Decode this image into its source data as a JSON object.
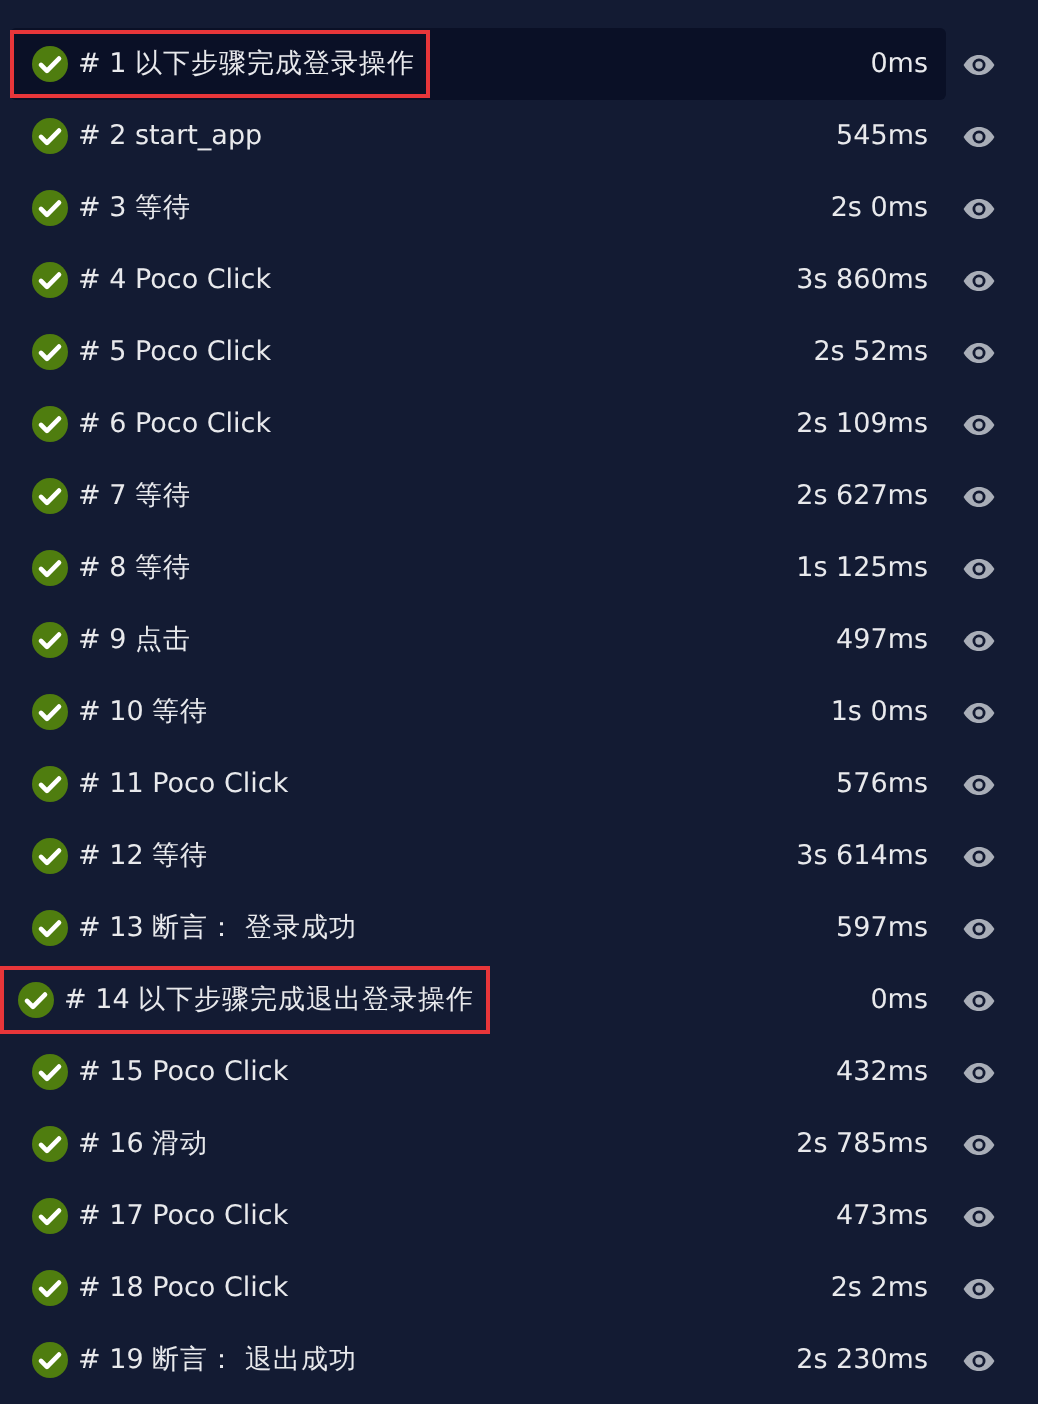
{
  "steps": [
    {
      "label": "# 1 以下步骤完成登录操作",
      "duration": "0ms",
      "passed": true,
      "selected": true,
      "flagged": true
    },
    {
      "label": "# 2 start_app",
      "duration": "545ms",
      "passed": true,
      "selected": false,
      "flagged": false
    },
    {
      "label": "# 3 等待",
      "duration": "2s 0ms",
      "passed": true,
      "selected": false,
      "flagged": false
    },
    {
      "label": "# 4 Poco Click",
      "duration": "3s 860ms",
      "passed": true,
      "selected": false,
      "flagged": false
    },
    {
      "label": "# 5 Poco Click",
      "duration": "2s 52ms",
      "passed": true,
      "selected": false,
      "flagged": false
    },
    {
      "label": "# 6 Poco Click",
      "duration": "2s 109ms",
      "passed": true,
      "selected": false,
      "flagged": false
    },
    {
      "label": "# 7 等待",
      "duration": "2s 627ms",
      "passed": true,
      "selected": false,
      "flagged": false
    },
    {
      "label": "# 8 等待",
      "duration": "1s 125ms",
      "passed": true,
      "selected": false,
      "flagged": false
    },
    {
      "label": "# 9 点击",
      "duration": "497ms",
      "passed": true,
      "selected": false,
      "flagged": false
    },
    {
      "label": "# 10 等待",
      "duration": "1s 0ms",
      "passed": true,
      "selected": false,
      "flagged": false
    },
    {
      "label": "# 11 Poco Click",
      "duration": "576ms",
      "passed": true,
      "selected": false,
      "flagged": false
    },
    {
      "label": "# 12 等待",
      "duration": "3s 614ms",
      "passed": true,
      "selected": false,
      "flagged": false
    },
    {
      "label": "# 13 断言：  登录成功",
      "duration": "597ms",
      "passed": true,
      "selected": false,
      "flagged": false
    },
    {
      "label": "# 14 以下步骤完成退出登录操作",
      "duration": "0ms",
      "passed": true,
      "selected": false,
      "flagged": true
    },
    {
      "label": "# 15 Poco Click",
      "duration": "432ms",
      "passed": true,
      "selected": false,
      "flagged": false
    },
    {
      "label": "# 16 滑动",
      "duration": "2s 785ms",
      "passed": true,
      "selected": false,
      "flagged": false
    },
    {
      "label": "# 17 Poco Click",
      "duration": "473ms",
      "passed": true,
      "selected": false,
      "flagged": false
    },
    {
      "label": "# 18 Poco Click",
      "duration": "2s 2ms",
      "passed": true,
      "selected": false,
      "flagged": false
    },
    {
      "label": "# 19 断言：  退出成功",
      "duration": "2s 230ms",
      "passed": true,
      "selected": false,
      "flagged": false
    }
  ]
}
